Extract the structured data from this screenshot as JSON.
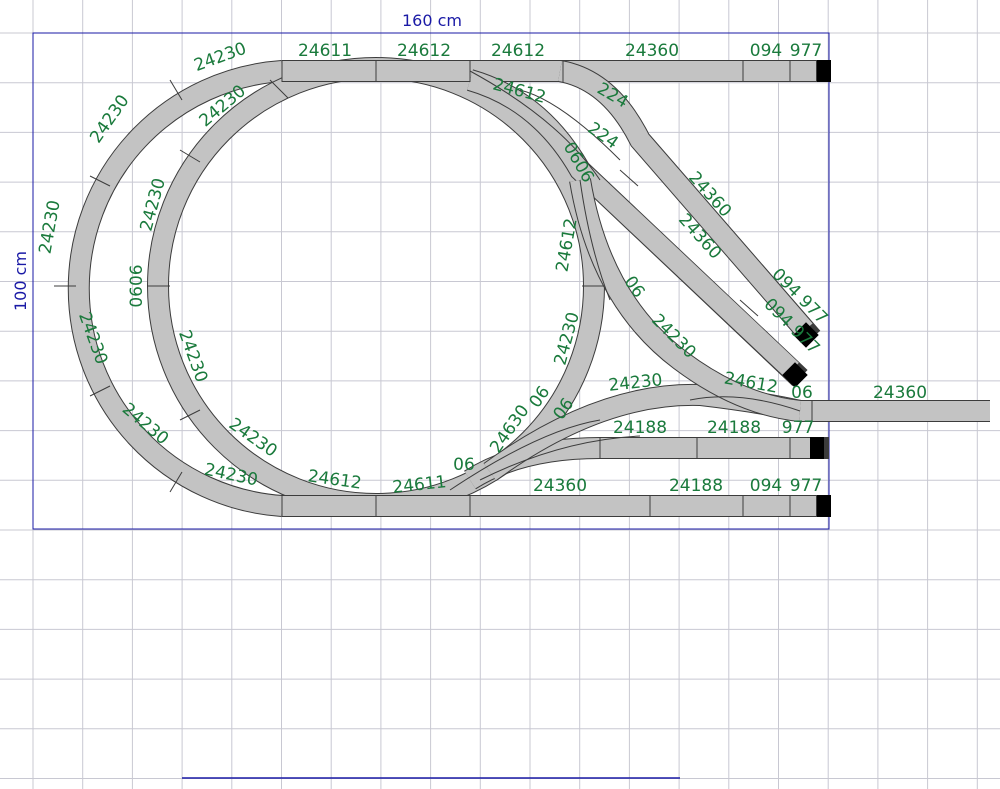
{
  "layout": {
    "dimensions": {
      "width": "160 cm",
      "height": "100 cm"
    },
    "track_labels": [
      "24611",
      "24612",
      "24612",
      "24360",
      "094",
      "977",
      "24230",
      "24230",
      "24230",
      "24230",
      "24230",
      "0606",
      "24230",
      "24230",
      "24230",
      "24230",
      "24230",
      "24612",
      "24611",
      "06",
      "24630",
      "06",
      "06",
      "24230",
      "24612",
      "06",
      "24360",
      "24188",
      "24188",
      "977",
      "24360",
      "24188",
      "094",
      "977",
      "24612",
      "224",
      "224",
      "0606",
      "24612",
      "24360",
      "24360",
      "094 977",
      "094 977",
      "06",
      "24230",
      "24230",
      "24230"
    ]
  },
  "colors": {
    "track_bed": "#c3c3c3",
    "track_edge": "#3c3c3c",
    "label": "#1a7a3c",
    "board_outline": "#1a1aa6",
    "grid": "#c8c8d2"
  }
}
